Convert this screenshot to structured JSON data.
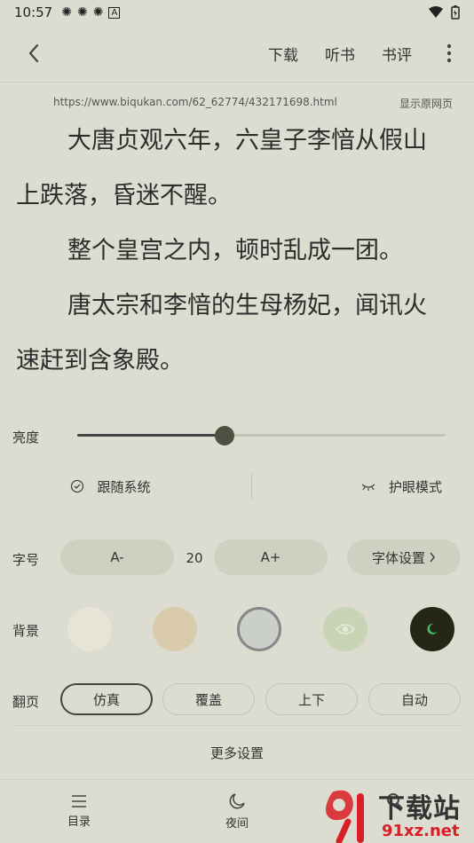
{
  "status_bar": {
    "time": "10:57"
  },
  "top_bar": {
    "actions": [
      "下载",
      "听书",
      "书评"
    ]
  },
  "source": {
    "url": "https://www.biqukan.com/62_62774/432171698.html",
    "show_original": "显示原网页"
  },
  "content": {
    "paragraphs": [
      "大唐贞观六年，六皇子李愔从假山上跌落，昏迷不醒。",
      "整个皇宫之内，顿时乱成一团。",
      "唐太宗和李愔的生母杨妃，闻讯火速赶到含象殿。"
    ]
  },
  "settings": {
    "brightness_label": "亮度",
    "brightness_value": 0.4,
    "follow_system": "跟随系统",
    "eye_care": "护眼模式",
    "font_label": "字号",
    "font_decrease": "A-",
    "font_size": "20",
    "font_increase": "A+",
    "font_settings": "字体设置",
    "background_label": "背景",
    "background_colors": [
      "#e6e4d6",
      "#d9cbac",
      "#cbcfca",
      "#c9d3b6",
      "#262616"
    ],
    "page_turn_label": "翻页",
    "page_turn_options": [
      "仿真",
      "覆盖",
      "上下",
      "自动"
    ],
    "more_settings": "更多设置"
  },
  "bottom_nav": {
    "items": [
      "目录",
      "夜间"
    ]
  },
  "watermark": {
    "text": "下载站",
    "domain": "91xz.net"
  }
}
